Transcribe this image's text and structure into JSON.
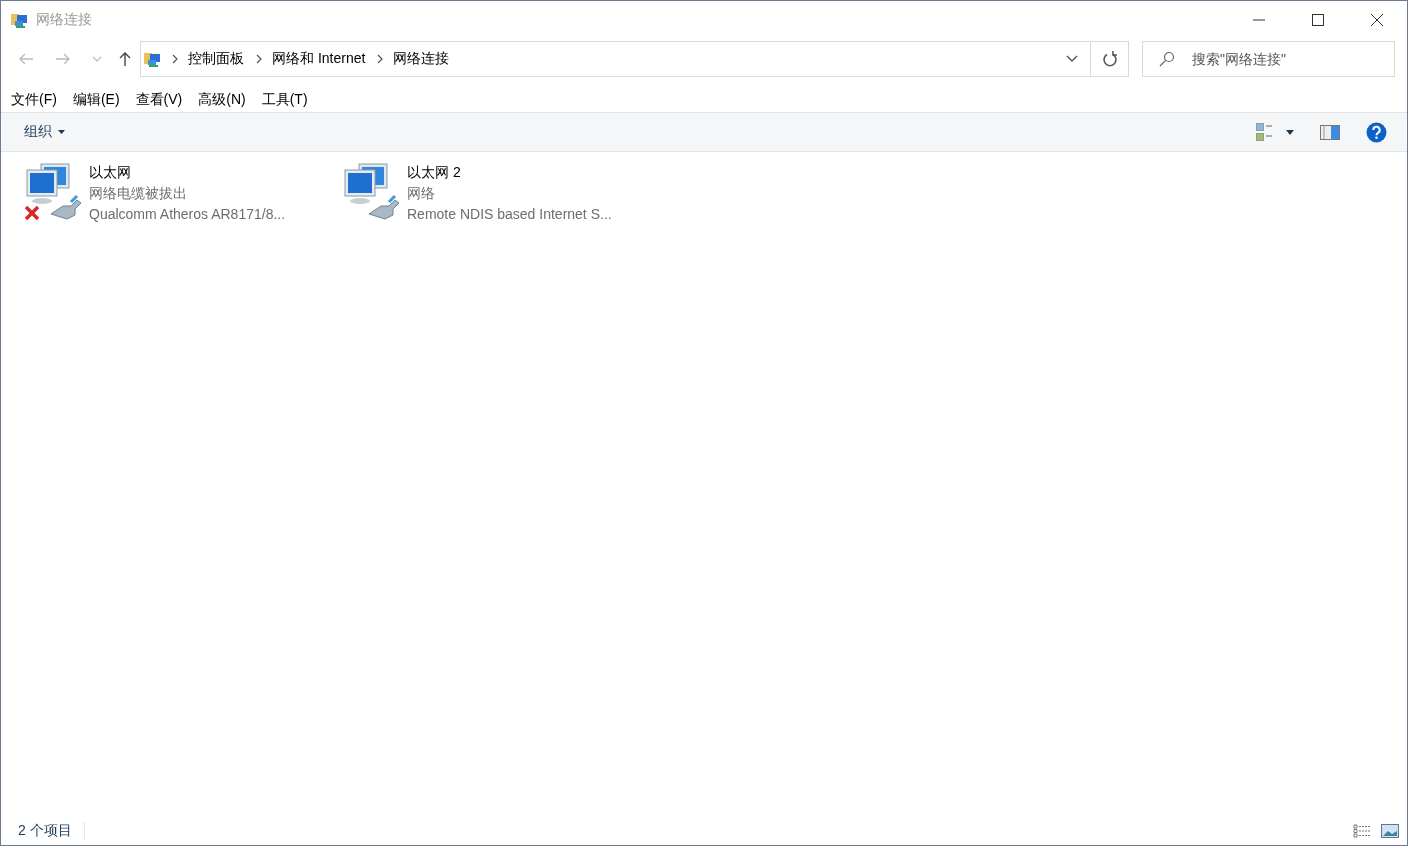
{
  "window": {
    "title": "网络连接"
  },
  "address_bar": {
    "breadcrumbs": [
      "控制面板",
      "网络和 Internet",
      "网络连接"
    ]
  },
  "search": {
    "placeholder": "搜索\"网络连接\""
  },
  "menu": [
    "文件(F)",
    "编辑(E)",
    "查看(V)",
    "高级(N)",
    "工具(T)"
  ],
  "toolbar": {
    "organize": "组织"
  },
  "connections": [
    {
      "name": "以太网",
      "status": "网络电缆被拔出",
      "adapter": "Qualcomm Atheros AR8171/8...",
      "disconnected": true
    },
    {
      "name": "以太网 2",
      "status": "网络",
      "adapter": "Remote NDIS based Internet S...",
      "disconnected": false
    }
  ],
  "status_bar": {
    "count": "2 个项目"
  }
}
